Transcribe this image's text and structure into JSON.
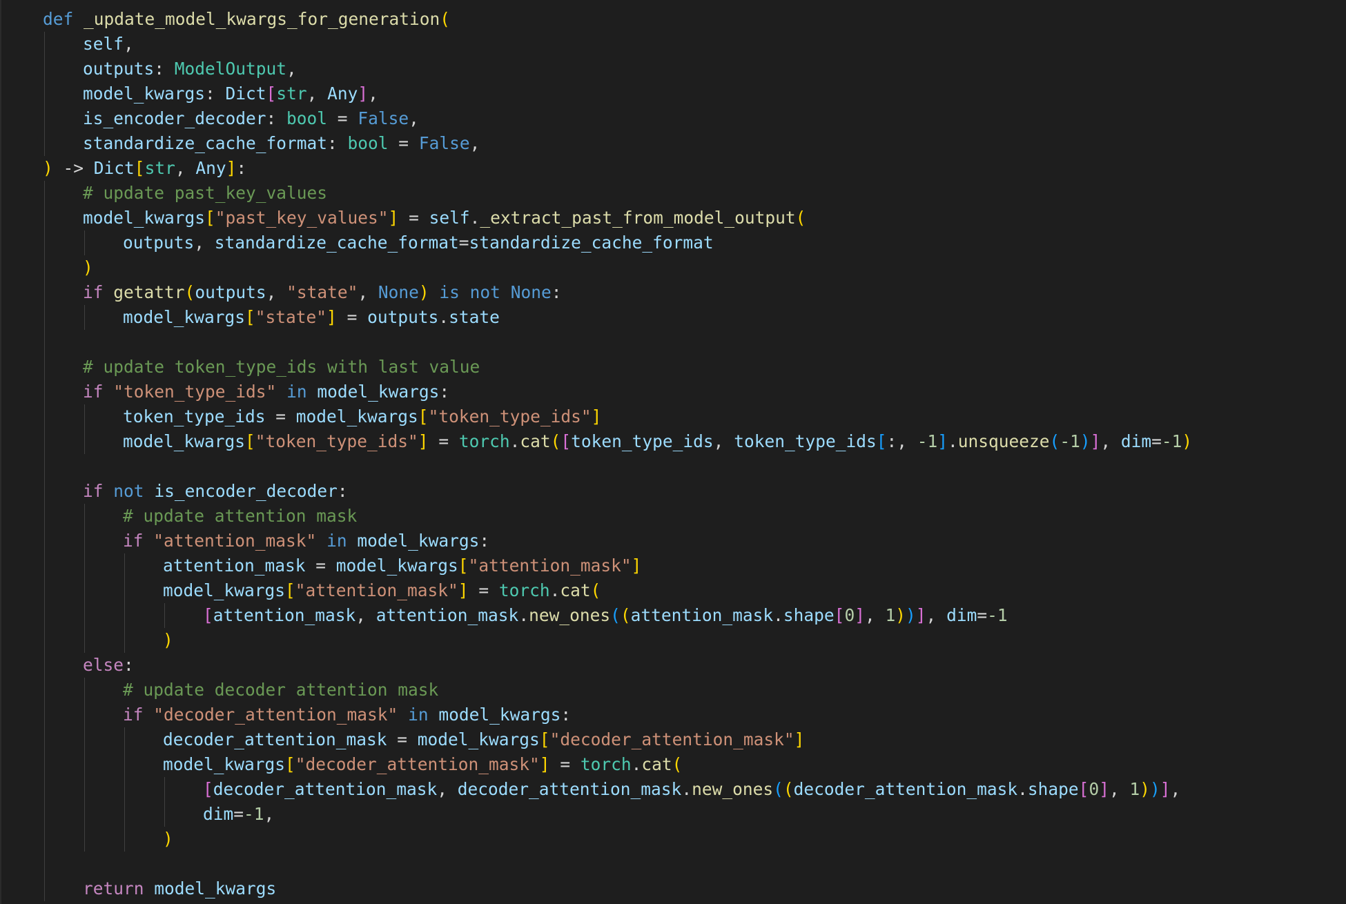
{
  "colors": {
    "background": "#1e1e1e",
    "keyword": "#569cd6",
    "control": "#c586c0",
    "function": "#dcdcaa",
    "variable": "#9cdcfe",
    "type": "#4ec9b0",
    "string": "#ce9178",
    "number": "#b5cea8",
    "comment": "#6a9955",
    "text": "#d4d4d4",
    "bracket1": "#ffd700",
    "bracket2": "#da70d6",
    "bracket3": "#179fff"
  },
  "lines": [
    {
      "indent": 1,
      "tokens": [
        [
          "def",
          "keyword"
        ],
        [
          " ",
          "text"
        ],
        [
          "_update_model_kwargs_for_generation",
          "function"
        ],
        [
          "(",
          "bracket1"
        ]
      ]
    },
    {
      "indent": 2,
      "tokens": [
        [
          "self",
          "variable"
        ],
        [
          ",",
          "text"
        ]
      ]
    },
    {
      "indent": 2,
      "tokens": [
        [
          "outputs",
          "variable"
        ],
        [
          ": ",
          "text"
        ],
        [
          "ModelOutput",
          "type"
        ],
        [
          ",",
          "text"
        ]
      ]
    },
    {
      "indent": 2,
      "tokens": [
        [
          "model_kwargs",
          "variable"
        ],
        [
          ": ",
          "text"
        ],
        [
          "Dict",
          "variable"
        ],
        [
          "[",
          "bracket2"
        ],
        [
          "str",
          "type"
        ],
        [
          ", ",
          "text"
        ],
        [
          "Any",
          "variable"
        ],
        [
          "]",
          "bracket2"
        ],
        [
          ",",
          "text"
        ]
      ]
    },
    {
      "indent": 2,
      "tokens": [
        [
          "is_encoder_decoder",
          "variable"
        ],
        [
          ": ",
          "text"
        ],
        [
          "bool",
          "type"
        ],
        [
          " = ",
          "text"
        ],
        [
          "False",
          "keyword"
        ],
        [
          ",",
          "text"
        ]
      ]
    },
    {
      "indent": 2,
      "tokens": [
        [
          "standardize_cache_format",
          "variable"
        ],
        [
          ": ",
          "text"
        ],
        [
          "bool",
          "type"
        ],
        [
          " = ",
          "text"
        ],
        [
          "False",
          "keyword"
        ],
        [
          ",",
          "text"
        ]
      ]
    },
    {
      "indent": 1,
      "tokens": [
        [
          ")",
          "bracket1"
        ],
        [
          " -> ",
          "text"
        ],
        [
          "Dict",
          "variable"
        ],
        [
          "[",
          "bracket1"
        ],
        [
          "str",
          "type"
        ],
        [
          ", ",
          "text"
        ],
        [
          "Any",
          "variable"
        ],
        [
          "]",
          "bracket1"
        ],
        [
          ":",
          "text"
        ]
      ]
    },
    {
      "indent": 2,
      "tokens": [
        [
          "# update past_key_values",
          "comment"
        ]
      ]
    },
    {
      "indent": 2,
      "tokens": [
        [
          "model_kwargs",
          "variable"
        ],
        [
          "[",
          "bracket1"
        ],
        [
          "\"past_key_values\"",
          "string"
        ],
        [
          "]",
          "bracket1"
        ],
        [
          " = ",
          "text"
        ],
        [
          "self",
          "variable"
        ],
        [
          ".",
          "text"
        ],
        [
          "_extract_past_from_model_output",
          "function"
        ],
        [
          "(",
          "bracket1"
        ]
      ]
    },
    {
      "indent": 3,
      "tokens": [
        [
          "outputs",
          "variable"
        ],
        [
          ", ",
          "text"
        ],
        [
          "standardize_cache_format",
          "variable"
        ],
        [
          "=",
          "text"
        ],
        [
          "standardize_cache_format",
          "variable"
        ]
      ]
    },
    {
      "indent": 2,
      "tokens": [
        [
          ")",
          "bracket1"
        ]
      ]
    },
    {
      "indent": 2,
      "tokens": [
        [
          "if",
          "control"
        ],
        [
          " ",
          "text"
        ],
        [
          "getattr",
          "function"
        ],
        [
          "(",
          "bracket1"
        ],
        [
          "outputs",
          "variable"
        ],
        [
          ", ",
          "text"
        ],
        [
          "\"state\"",
          "string"
        ],
        [
          ", ",
          "text"
        ],
        [
          "None",
          "keyword"
        ],
        [
          ")",
          "bracket1"
        ],
        [
          " ",
          "text"
        ],
        [
          "is not",
          "keyword"
        ],
        [
          " ",
          "text"
        ],
        [
          "None",
          "keyword"
        ],
        [
          ":",
          "text"
        ]
      ]
    },
    {
      "indent": 3,
      "tokens": [
        [
          "model_kwargs",
          "variable"
        ],
        [
          "[",
          "bracket1"
        ],
        [
          "\"state\"",
          "string"
        ],
        [
          "]",
          "bracket1"
        ],
        [
          " = ",
          "text"
        ],
        [
          "outputs",
          "variable"
        ],
        [
          ".",
          "text"
        ],
        [
          "state",
          "variable"
        ]
      ]
    },
    {
      "indent": 2,
      "tokens": []
    },
    {
      "indent": 2,
      "tokens": [
        [
          "# update token_type_ids with last value",
          "comment"
        ]
      ]
    },
    {
      "indent": 2,
      "tokens": [
        [
          "if",
          "control"
        ],
        [
          " ",
          "text"
        ],
        [
          "\"token_type_ids\"",
          "string"
        ],
        [
          " ",
          "text"
        ],
        [
          "in",
          "keyword"
        ],
        [
          " ",
          "text"
        ],
        [
          "model_kwargs",
          "variable"
        ],
        [
          ":",
          "text"
        ]
      ]
    },
    {
      "indent": 3,
      "tokens": [
        [
          "token_type_ids",
          "variable"
        ],
        [
          " = ",
          "text"
        ],
        [
          "model_kwargs",
          "variable"
        ],
        [
          "[",
          "bracket1"
        ],
        [
          "\"token_type_ids\"",
          "string"
        ],
        [
          "]",
          "bracket1"
        ]
      ]
    },
    {
      "indent": 3,
      "tokens": [
        [
          "model_kwargs",
          "variable"
        ],
        [
          "[",
          "bracket1"
        ],
        [
          "\"token_type_ids\"",
          "string"
        ],
        [
          "]",
          "bracket1"
        ],
        [
          " = ",
          "text"
        ],
        [
          "torch",
          "type"
        ],
        [
          ".",
          "text"
        ],
        [
          "cat",
          "function"
        ],
        [
          "(",
          "bracket1"
        ],
        [
          "[",
          "bracket2"
        ],
        [
          "token_type_ids",
          "variable"
        ],
        [
          ", ",
          "text"
        ],
        [
          "token_type_ids",
          "variable"
        ],
        [
          "[",
          "bracket3"
        ],
        [
          ":, ",
          "text"
        ],
        [
          "-1",
          "number"
        ],
        [
          "]",
          "bracket3"
        ],
        [
          ".",
          "text"
        ],
        [
          "unsqueeze",
          "function"
        ],
        [
          "(",
          "bracket3"
        ],
        [
          "-1",
          "number"
        ],
        [
          ")",
          "bracket3"
        ],
        [
          "]",
          "bracket2"
        ],
        [
          ", ",
          "text"
        ],
        [
          "dim",
          "variable"
        ],
        [
          "=",
          "text"
        ],
        [
          "-1",
          "number"
        ],
        [
          ")",
          "bracket1"
        ]
      ]
    },
    {
      "indent": 2,
      "tokens": []
    },
    {
      "indent": 2,
      "tokens": [
        [
          "if",
          "control"
        ],
        [
          " ",
          "text"
        ],
        [
          "not",
          "keyword"
        ],
        [
          " ",
          "text"
        ],
        [
          "is_encoder_decoder",
          "variable"
        ],
        [
          ":",
          "text"
        ]
      ]
    },
    {
      "indent": 3,
      "tokens": [
        [
          "# update attention mask",
          "comment"
        ]
      ]
    },
    {
      "indent": 3,
      "tokens": [
        [
          "if",
          "control"
        ],
        [
          " ",
          "text"
        ],
        [
          "\"attention_mask\"",
          "string"
        ],
        [
          " ",
          "text"
        ],
        [
          "in",
          "keyword"
        ],
        [
          " ",
          "text"
        ],
        [
          "model_kwargs",
          "variable"
        ],
        [
          ":",
          "text"
        ]
      ]
    },
    {
      "indent": 4,
      "tokens": [
        [
          "attention_mask",
          "variable"
        ],
        [
          " = ",
          "text"
        ],
        [
          "model_kwargs",
          "variable"
        ],
        [
          "[",
          "bracket1"
        ],
        [
          "\"attention_mask\"",
          "string"
        ],
        [
          "]",
          "bracket1"
        ]
      ]
    },
    {
      "indent": 4,
      "tokens": [
        [
          "model_kwargs",
          "variable"
        ],
        [
          "[",
          "bracket1"
        ],
        [
          "\"attention_mask\"",
          "string"
        ],
        [
          "]",
          "bracket1"
        ],
        [
          " = ",
          "text"
        ],
        [
          "torch",
          "type"
        ],
        [
          ".",
          "text"
        ],
        [
          "cat",
          "function"
        ],
        [
          "(",
          "bracket1"
        ]
      ]
    },
    {
      "indent": 5,
      "tokens": [
        [
          "[",
          "bracket2"
        ],
        [
          "attention_mask",
          "variable"
        ],
        [
          ", ",
          "text"
        ],
        [
          "attention_mask",
          "variable"
        ],
        [
          ".",
          "text"
        ],
        [
          "new_ones",
          "function"
        ],
        [
          "(",
          "bracket3"
        ],
        [
          "(",
          "bracket1"
        ],
        [
          "attention_mask",
          "variable"
        ],
        [
          ".",
          "text"
        ],
        [
          "shape",
          "variable"
        ],
        [
          "[",
          "bracket2"
        ],
        [
          "0",
          "number"
        ],
        [
          "]",
          "bracket2"
        ],
        [
          ", ",
          "text"
        ],
        [
          "1",
          "number"
        ],
        [
          ")",
          "bracket1"
        ],
        [
          ")",
          "bracket3"
        ],
        [
          "]",
          "bracket2"
        ],
        [
          ", ",
          "text"
        ],
        [
          "dim",
          "variable"
        ],
        [
          "=",
          "text"
        ],
        [
          "-1",
          "number"
        ]
      ]
    },
    {
      "indent": 4,
      "tokens": [
        [
          ")",
          "bracket1"
        ]
      ]
    },
    {
      "indent": 2,
      "tokens": [
        [
          "else",
          "control"
        ],
        [
          ":",
          "text"
        ]
      ]
    },
    {
      "indent": 3,
      "tokens": [
        [
          "# update decoder attention mask",
          "comment"
        ]
      ]
    },
    {
      "indent": 3,
      "tokens": [
        [
          "if",
          "control"
        ],
        [
          " ",
          "text"
        ],
        [
          "\"decoder_attention_mask\"",
          "string"
        ],
        [
          " ",
          "text"
        ],
        [
          "in",
          "keyword"
        ],
        [
          " ",
          "text"
        ],
        [
          "model_kwargs",
          "variable"
        ],
        [
          ":",
          "text"
        ]
      ]
    },
    {
      "indent": 4,
      "tokens": [
        [
          "decoder_attention_mask",
          "variable"
        ],
        [
          " = ",
          "text"
        ],
        [
          "model_kwargs",
          "variable"
        ],
        [
          "[",
          "bracket1"
        ],
        [
          "\"decoder_attention_mask\"",
          "string"
        ],
        [
          "]",
          "bracket1"
        ]
      ]
    },
    {
      "indent": 4,
      "tokens": [
        [
          "model_kwargs",
          "variable"
        ],
        [
          "[",
          "bracket1"
        ],
        [
          "\"decoder_attention_mask\"",
          "string"
        ],
        [
          "]",
          "bracket1"
        ],
        [
          " = ",
          "text"
        ],
        [
          "torch",
          "type"
        ],
        [
          ".",
          "text"
        ],
        [
          "cat",
          "function"
        ],
        [
          "(",
          "bracket1"
        ]
      ]
    },
    {
      "indent": 5,
      "tokens": [
        [
          "[",
          "bracket2"
        ],
        [
          "decoder_attention_mask",
          "variable"
        ],
        [
          ", ",
          "text"
        ],
        [
          "decoder_attention_mask",
          "variable"
        ],
        [
          ".",
          "text"
        ],
        [
          "new_ones",
          "function"
        ],
        [
          "(",
          "bracket3"
        ],
        [
          "(",
          "bracket1"
        ],
        [
          "decoder_attention_mask",
          "variable"
        ],
        [
          ".",
          "text"
        ],
        [
          "shape",
          "variable"
        ],
        [
          "[",
          "bracket2"
        ],
        [
          "0",
          "number"
        ],
        [
          "]",
          "bracket2"
        ],
        [
          ", ",
          "text"
        ],
        [
          "1",
          "number"
        ],
        [
          ")",
          "bracket1"
        ],
        [
          ")",
          "bracket3"
        ],
        [
          "]",
          "bracket2"
        ],
        [
          ",",
          "text"
        ]
      ]
    },
    {
      "indent": 5,
      "tokens": [
        [
          "dim",
          "variable"
        ],
        [
          "=",
          "text"
        ],
        [
          "-1",
          "number"
        ],
        [
          ",",
          "text"
        ]
      ]
    },
    {
      "indent": 4,
      "tokens": [
        [
          ")",
          "bracket1"
        ]
      ]
    },
    {
      "indent": 2,
      "tokens": []
    },
    {
      "indent": 2,
      "tokens": [
        [
          "return",
          "control"
        ],
        [
          " ",
          "text"
        ],
        [
          "model_kwargs",
          "variable"
        ]
      ]
    }
  ]
}
